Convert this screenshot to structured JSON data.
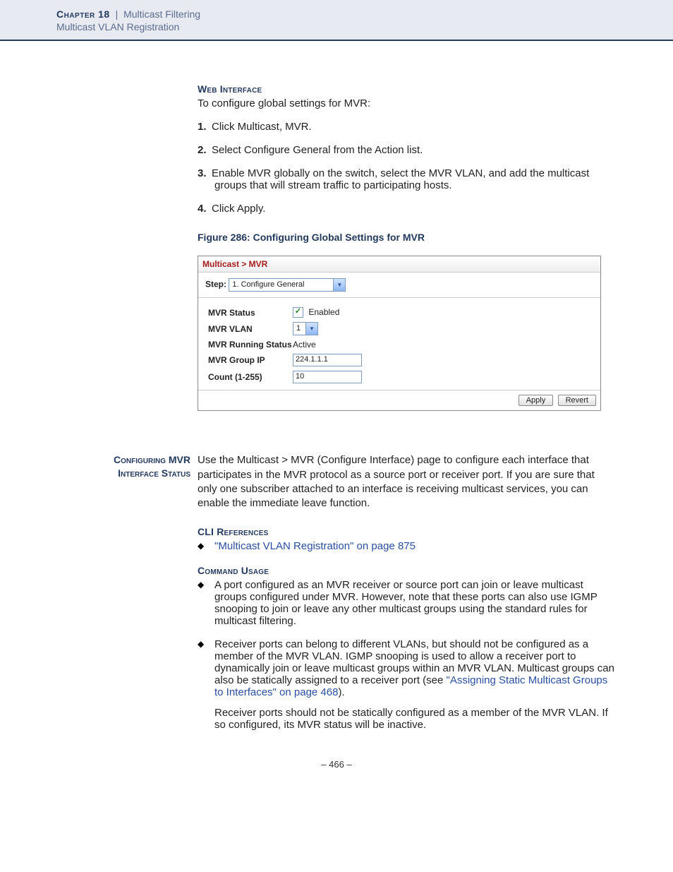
{
  "header": {
    "chapter": "Chapter 18",
    "separator": "|",
    "title": "Multicast Filtering",
    "subtitle": "Multicast VLAN Registration"
  },
  "web_interface": {
    "heading": "Web Interface",
    "intro": "To configure global settings for MVR:",
    "steps": [
      "Click Multicast, MVR.",
      "Select Configure General from the Action list.",
      "Enable MVR globally on the switch, select the MVR VLAN, and add the multicast groups that will stream traffic to participating hosts.",
      "Click Apply."
    ]
  },
  "figure": {
    "caption": "Figure 286:  Configuring Global Settings for MVR"
  },
  "ui": {
    "breadcrumb": "Multicast > MVR",
    "step_label": "Step:",
    "step_value": "1. Configure General",
    "rows": {
      "mvr_status_k": "MVR Status",
      "mvr_status_enabled": "Enabled",
      "mvr_vlan_k": "MVR VLAN",
      "mvr_vlan_v": "1",
      "mvr_running_k": "MVR Running Status",
      "mvr_running_v": "Active",
      "mvr_group_ip_k": "MVR Group IP",
      "mvr_group_ip_v": "224.1.1.1",
      "count_k": "Count (1-255)",
      "count_v": "10"
    },
    "buttons": {
      "apply": "Apply",
      "revert": "Revert"
    }
  },
  "section2": {
    "side_label_l1": "Configuring MVR",
    "side_label_l2": "Interface Status",
    "para": "Use the Multicast > MVR (Configure Interface) page to configure each interface that participates in the MVR protocol as a source port or receiver port. If you are sure that only one subscriber attached to an interface is receiving multicast services, you can enable the immediate leave function."
  },
  "cli_refs": {
    "heading": "CLI References",
    "link": "\"Multicast VLAN Registration\" on page 875"
  },
  "cmd_usage": {
    "heading": "Command Usage",
    "b1": "A port configured as an MVR receiver or source port can join or leave multicast groups configured under MVR. However, note that these ports can also use IGMP snooping to join or leave any other multicast groups using the standard rules for multicast filtering.",
    "b2_a": "Receiver ports can belong to different VLANs, but should not be configured as a member of the MVR VLAN. IGMP snooping is used to allow a receiver port to dynamically join or leave multicast groups within an MVR VLAN. Multicast groups can also be statically assigned to a receiver port (see ",
    "b2_link": "\"Assigning Static Multicast Groups to Interfaces\" on page 468",
    "b2_b": ").",
    "b2_sub": "Receiver ports should not be statically configured as a member of the MVR VLAN. If so configured, its MVR status will be inactive."
  },
  "pagenum": "–  466  –"
}
